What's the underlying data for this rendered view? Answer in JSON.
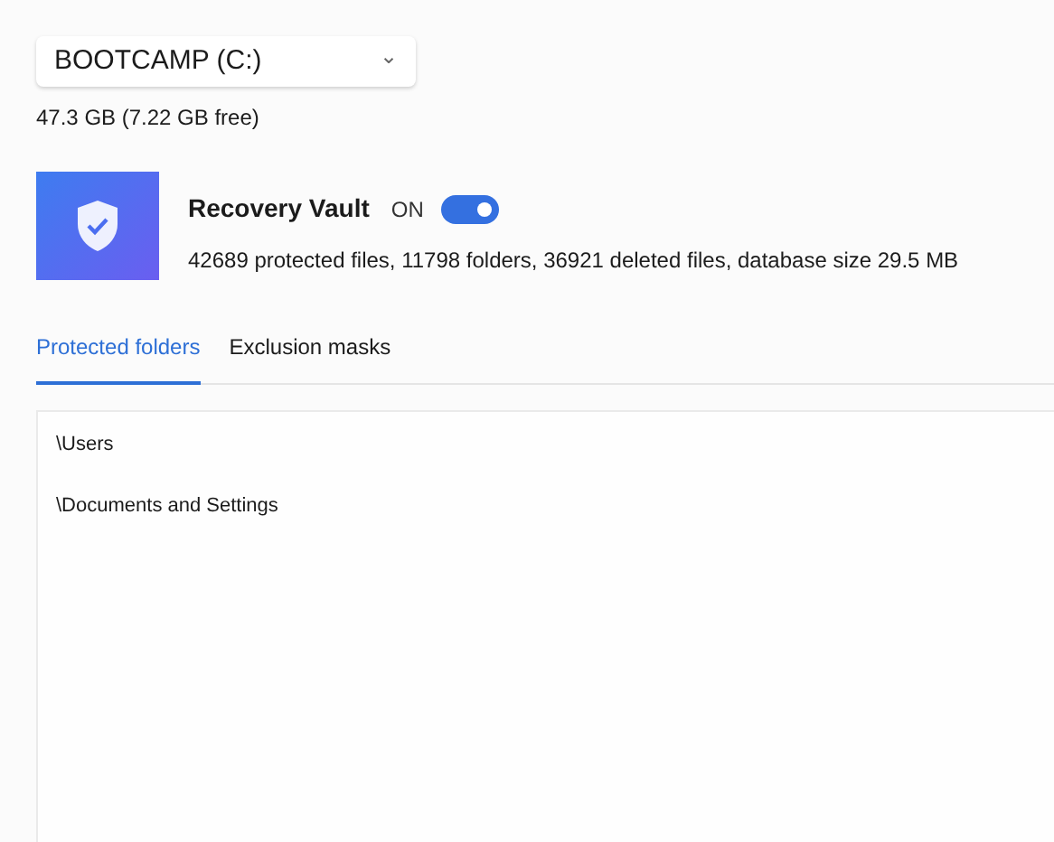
{
  "drive": {
    "label": "BOOTCAMP (C:)",
    "caret": "⌄"
  },
  "capacity": "47.3 GB (7.22 GB free)",
  "vault": {
    "title": "Recovery Vault",
    "status_label": "ON",
    "on": true,
    "stats": "42689 protected files, 11798 folders, 36921 deleted files, database size 29.5 MB"
  },
  "tabs": [
    {
      "label": "Protected folders",
      "selected": true
    },
    {
      "label": "Exclusion masks",
      "selected": false
    }
  ],
  "folders": [
    "\\Users",
    "\\Documents and Settings"
  ]
}
